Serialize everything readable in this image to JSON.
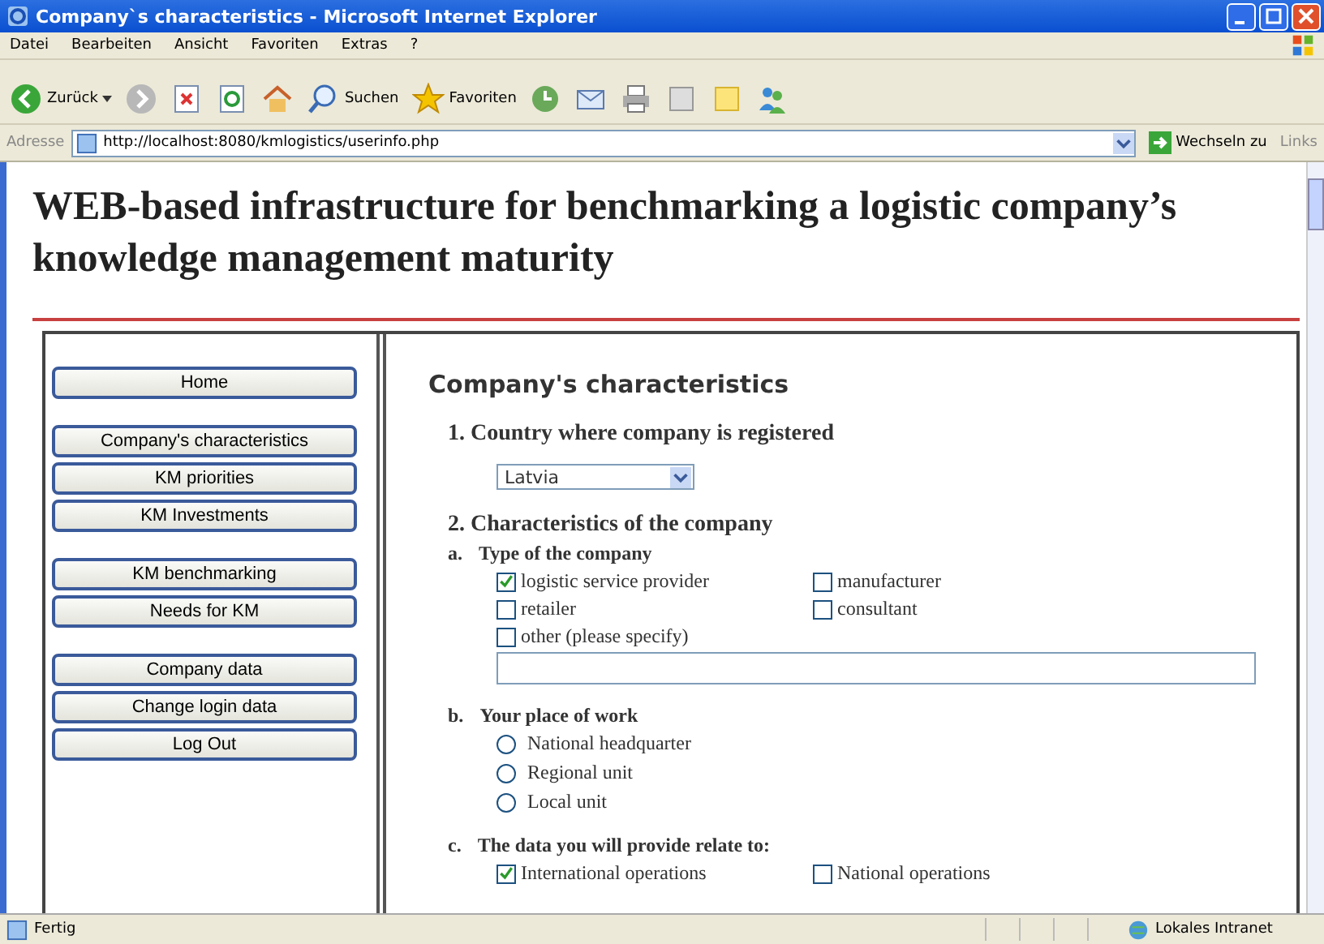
{
  "window": {
    "title": "Company`s characteristics - Microsoft Internet Explorer"
  },
  "menu": [
    "Datei",
    "Bearbeiten",
    "Ansicht",
    "Favoriten",
    "Extras",
    "?"
  ],
  "toolbar": {
    "back": "Zurück",
    "search": "Suchen",
    "favorites": "Favoriten"
  },
  "address_bar": {
    "label": "Adresse",
    "url": "http://localhost:8080/kmlogistics/userinfo.php",
    "go": "Wechseln zu",
    "links": "Links"
  },
  "page_title": "WEB-based infrastructure for benchmarking a logistic company’s knowledge management maturity",
  "nav_groups": [
    [
      "Home"
    ],
    [
      "Company's characteristics",
      "KM priorities",
      "KM Investments"
    ],
    [
      "KM benchmarking",
      "Needs for KM"
    ],
    [
      "Company data",
      "Change login data",
      "Log Out"
    ]
  ],
  "form": {
    "heading": "Company's characteristics",
    "q1": {
      "title": "1. Country where company is registered",
      "country": "Latvia"
    },
    "q2": {
      "title": "2. Characteristics of the company",
      "a": {
        "mark": "a.",
        "title": "Type of the company",
        "options": [
          {
            "label": "logistic service provider",
            "checked": true
          },
          {
            "label": "manufacturer",
            "checked": false
          },
          {
            "label": "retailer",
            "checked": false
          },
          {
            "label": "consultant",
            "checked": false
          }
        ],
        "other": {
          "label": "other (please specify)",
          "checked": false
        }
      },
      "b": {
        "mark": "b.",
        "title": "Your place of work",
        "options": [
          {
            "label": "National headquarter",
            "selected": false
          },
          {
            "label": "Regional unit",
            "selected": false
          },
          {
            "label": "Local unit",
            "selected": false
          }
        ]
      },
      "c": {
        "mark": "c.",
        "title": "The data you will provide relate to:",
        "options": [
          {
            "label": "International operations",
            "checked": true
          },
          {
            "label": "National operations",
            "checked": false
          }
        ]
      }
    }
  },
  "status_bar": {
    "text": "Fertig",
    "zone": "Lokales Intranet"
  }
}
